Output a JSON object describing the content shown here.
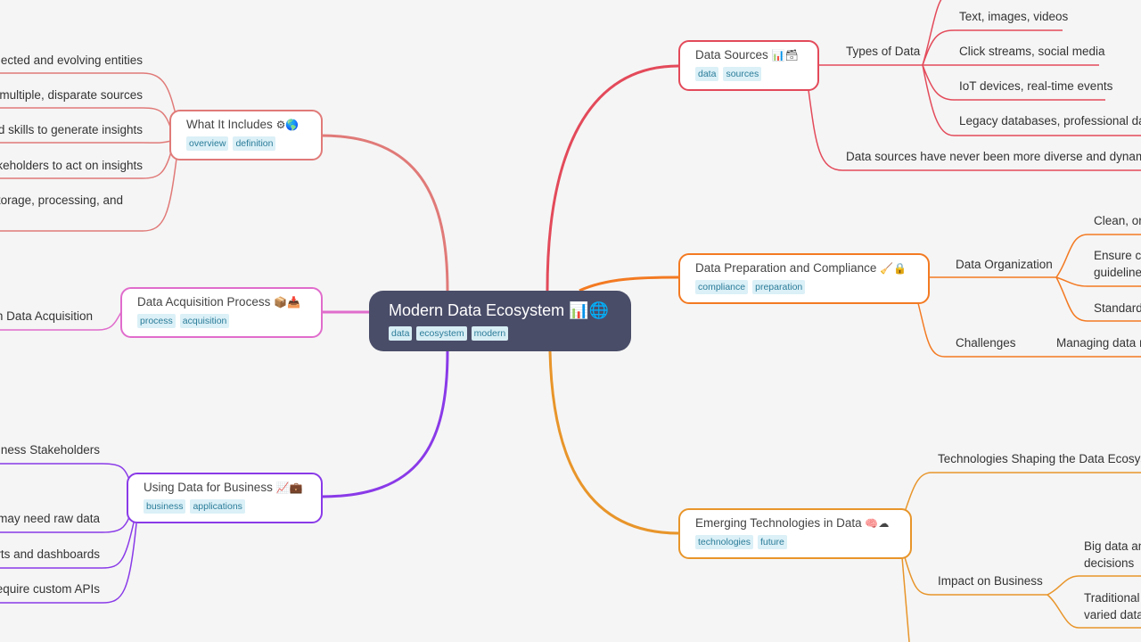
{
  "root": {
    "title": "Modern Data Ecosystem",
    "icons": "📊🌐",
    "tags": [
      "data",
      "ecosystem",
      "modern"
    ]
  },
  "colors": {
    "what_it_includes": "#e07a78",
    "acquisition": "#e06ccc",
    "business": "#8a3ae8",
    "sources": "#e34a5a",
    "preparation": "#f37a22",
    "emerging": "#e8952a"
  },
  "branches": {
    "what_it_includes": {
      "title": "What It Includes",
      "icons": "⚙🌎",
      "tags": [
        "overview",
        "definition"
      ],
      "children": [
        "ected and evolving entities",
        "multiple, disparate sources",
        "d skills to generate insights",
        "keholders to act on insights",
        "torage, processing, and"
      ]
    },
    "acquisition": {
      "title": "Data Acquisition Process",
      "icons": "📦📥",
      "tags": [
        "process",
        "acquisition"
      ],
      "children": [
        "n Data Acquisition"
      ]
    },
    "business": {
      "title": "Using Data for Business",
      "icons": "📈💼",
      "tags": [
        "business",
        "applications"
      ],
      "children": [
        "iness Stakeholders",
        "may need raw data",
        "rts and dashboards",
        "equire custom APIs"
      ]
    },
    "sources": {
      "title": "Data Sources",
      "icons": "📊🗃",
      "tags": [
        "data",
        "sources"
      ],
      "types_label": "Types of Data",
      "types": [
        "Text, images, videos",
        "Click streams, social media",
        "IoT devices, real-time events",
        "Legacy databases, professional da"
      ],
      "note": "Data sources have never been more diverse and dynami"
    },
    "preparation": {
      "title": "Data Preparation and Compliance",
      "icons": "🧹🔒",
      "tags": [
        "compliance",
        "preparation"
      ],
      "organization_label": "Data Organization",
      "organization": [
        "Clean, or",
        "Ensure co guideline",
        "Standard"
      ],
      "challenges_label": "Challenges",
      "challenges": [
        "Managing data r"
      ]
    },
    "emerging": {
      "title": "Emerging Technologies in Data",
      "icons": "🧠☁",
      "tags": [
        "technologies",
        "future"
      ],
      "shaping_label": "Technologies Shaping the Data Ecosys",
      "impact_label": "Impact on Business",
      "impact": [
        "Big data an decisions",
        "Traditional varied data"
      ]
    }
  }
}
